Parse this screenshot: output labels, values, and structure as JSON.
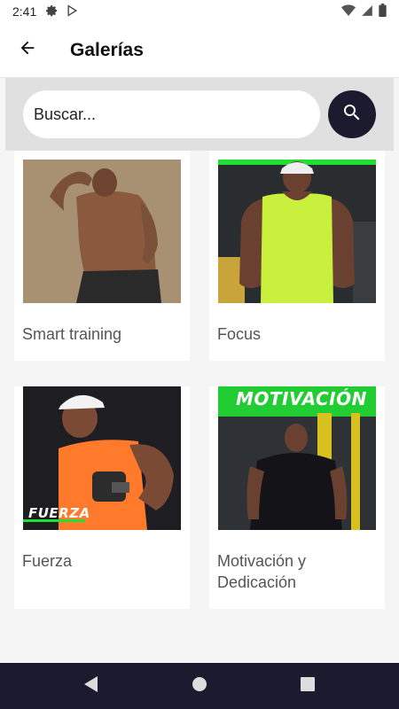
{
  "status_bar": {
    "time": "2:41",
    "icons": [
      "gear-icon",
      "play-store-icon",
      "wifi-icon",
      "signal-icon",
      "battery-icon"
    ]
  },
  "app_bar": {
    "title": "Galerías",
    "back_icon": "arrow-back-icon"
  },
  "search": {
    "placeholder": "Buscar...",
    "value": "",
    "button_icon": "search-icon"
  },
  "galleries": [
    {
      "label": "Smart training",
      "image": "muscular man flexing biceps"
    },
    {
      "label": "Focus",
      "image": "man in lime tank top in gym"
    },
    {
      "label": "Fuerza",
      "image": "man in orange tank top holding dumbbell",
      "overlay": "FUERZA"
    },
    {
      "label": "Motivación y Dedicación",
      "image": "man in black t-shirt in gym",
      "overlay": "MOTIVACIÓN"
    }
  ],
  "colors": {
    "accent_dark": "#1c1a2e",
    "accent_green": "#22dd33",
    "label_gray": "#555555"
  },
  "nav_bar": {
    "icons": [
      "back-triangle-icon",
      "home-circle-icon",
      "recents-square-icon"
    ]
  }
}
